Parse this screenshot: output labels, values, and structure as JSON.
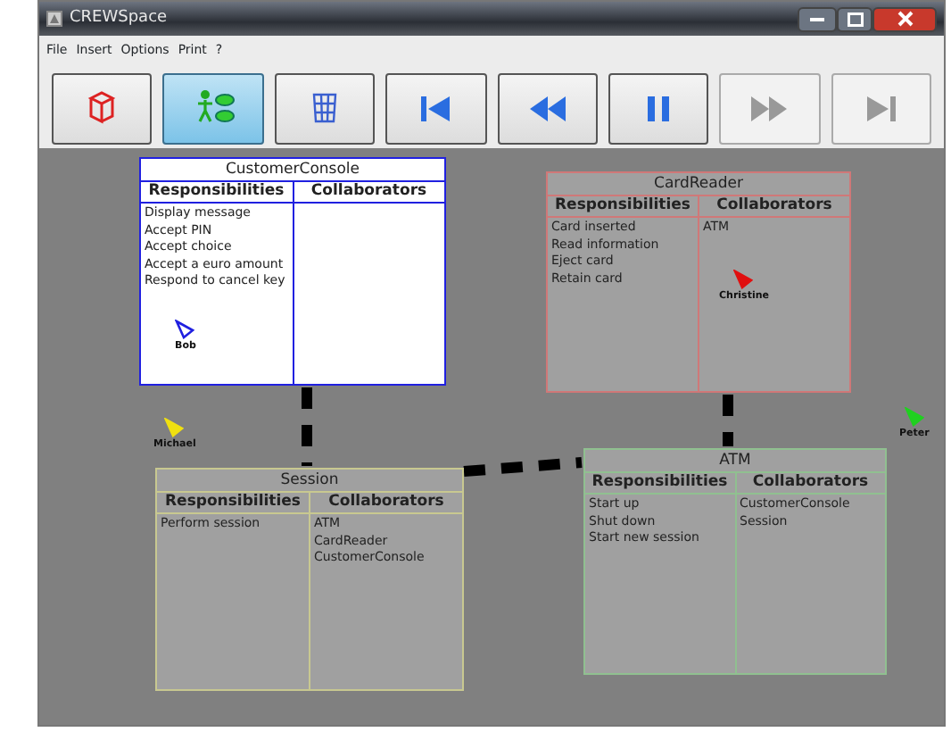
{
  "window": {
    "title": "CREWSpace"
  },
  "menu": [
    "File",
    "Insert",
    "Options",
    "Print",
    "?"
  ],
  "toolbar": [
    {
      "kind": "uml",
      "selected": false,
      "disabled": false
    },
    {
      "kind": "usecase",
      "selected": true,
      "disabled": false
    },
    {
      "kind": "grid",
      "selected": false,
      "disabled": false
    },
    {
      "kind": "first",
      "selected": false,
      "disabled": false
    },
    {
      "kind": "rewind",
      "selected": false,
      "disabled": false
    },
    {
      "kind": "pause",
      "selected": false,
      "disabled": false
    },
    {
      "kind": "forward",
      "selected": false,
      "disabled": true
    },
    {
      "kind": "last",
      "selected": false,
      "disabled": true
    }
  ],
  "cards": [
    {
      "name": "CustomerConsole",
      "color": "#2020e0",
      "focused": true,
      "responsibilities_heading": "Responsibilities",
      "collaborators_heading": "Collaborators",
      "responsibilities": [
        "Display message",
        "Accept PIN",
        "Accept choice",
        "Accept a euro amount",
        "Respond to cancel key"
      ]
    },
    {
      "name": "CardReader",
      "color": "#d07878",
      "focused": false,
      "responsibilities_heading": "Responsibilities",
      "collaborators_heading": "Collaborators",
      "responsibilities": [
        "Card inserted",
        "Read information",
        "Eject card",
        "Retain card"
      ],
      "collaborators": [
        "ATM"
      ]
    },
    {
      "name": "Session",
      "color": "#c8c890",
      "focused": false,
      "responsibilities_heading": "Responsibilities",
      "collaborators_heading": "Collaborators",
      "responsibilities": [
        "Perform session"
      ],
      "collaborators": [
        "ATM",
        "CardReader",
        "CustomerConsole"
      ]
    },
    {
      "name": "ATM",
      "color": "#90c090",
      "focused": false,
      "responsibilities_heading": "Responsibilities",
      "collaborators_heading": "Collaborators",
      "responsibilities": [
        "Start up",
        "Shut down",
        "Start new session"
      ],
      "collaborators": [
        "CustomerConsole",
        "Session"
      ]
    }
  ],
  "users": [
    {
      "name": "Bob",
      "color": "#2020e0",
      "outline": true
    },
    {
      "name": "Christine",
      "color": "#e01010",
      "outline": false
    },
    {
      "name": "Michael",
      "color": "#f0e010",
      "outline": false
    },
    {
      "name": "Peter",
      "color": "#20d020",
      "outline": false
    }
  ]
}
